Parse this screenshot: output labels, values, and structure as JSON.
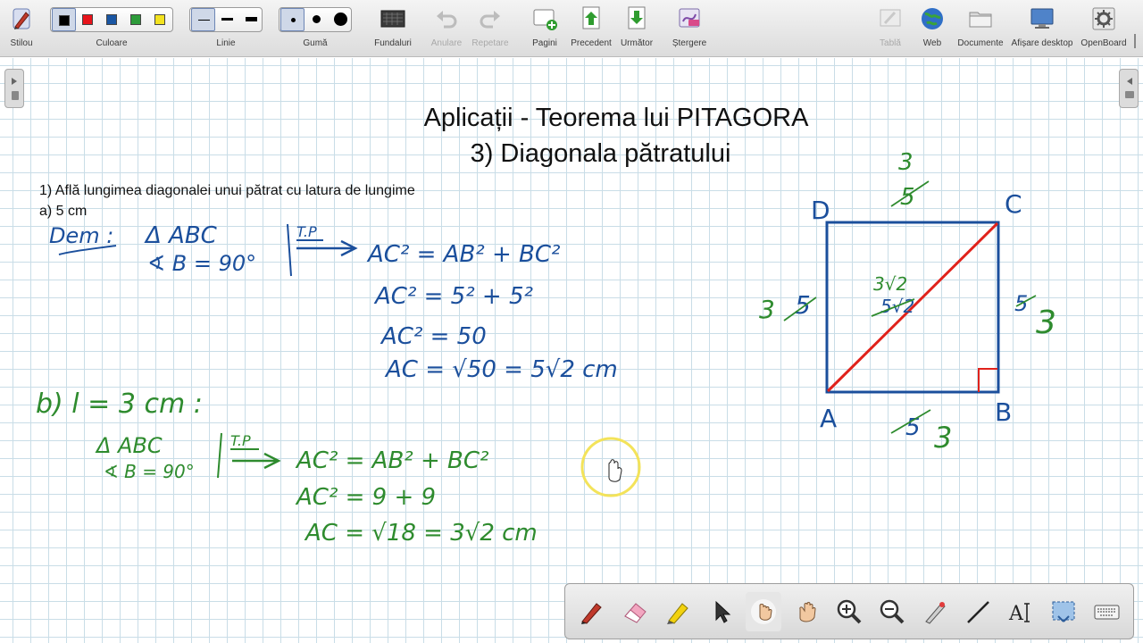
{
  "toolbar": {
    "pen_label": "Stilou",
    "color_label": "Culoare",
    "line_label": "Linie",
    "eraser_label": "Gumă",
    "backgrounds_label": "Fundaluri",
    "undo_label": "Anulare",
    "redo_label": "Repetare",
    "pages_label": "Pagini",
    "previous_label": "Precedent",
    "next_label": "Următor",
    "clear_label": "Ștergere",
    "board_label": "Tablă",
    "web_label": "Web",
    "documents_label": "Documente",
    "desktop_label": "Afișare desktop",
    "openboard_label": "OpenBoard",
    "colors": [
      "#000000",
      "#e8141b",
      "#1a56a3",
      "#2d9b3a",
      "#f3e21f"
    ],
    "selected_color": "#000000"
  },
  "board": {
    "title": "Aplicații - Teorema lui PITAGORA",
    "subtitle": "3) Diagonala pătratului",
    "problem_text": "1) Află lungimea diagonalei unui pătrat cu latura de lungime",
    "part_a": "a) 5 cm"
  },
  "handwriting": {
    "dem": "Dem :",
    "triangle_abc_a": "Δ ABC",
    "angle_b_a": "∢ B = 90°",
    "tp_a": "T.P",
    "eq_a1": "AC² = AB² + BC²",
    "eq_a2": "AC² = 5² + 5²",
    "eq_a3": "AC² = 50",
    "eq_a4": "AC = √50 = 5√2 cm",
    "part_b": "b) l = 3 cm :",
    "triangle_abc_b": "Δ ABC",
    "angle_b_b": "∢ B = 90°",
    "tp_b": "T.P",
    "eq_b1": "AC² = AB² + BC²",
    "eq_b2": "AC² = 9 + 9",
    "eq_b3": "AC = √18 = 3√2 cm",
    "vertex_a": "A",
    "vertex_b": "B",
    "vertex_c": "C",
    "vertex_d": "D",
    "side_top_old": "5",
    "side_top_new": "3",
    "side_left_old": "5",
    "side_left_new": "3",
    "side_right_old": "5",
    "side_right_new": "3",
    "side_bottom_old": "5",
    "side_bottom_new": "3",
    "diag_old": "5√2",
    "diag_new": "3√2"
  },
  "colors": {
    "ink_blue": "#1b4f9c",
    "ink_green": "#2e8b2e",
    "ink_red": "#e0221b",
    "highlight": "#f3e35a"
  }
}
